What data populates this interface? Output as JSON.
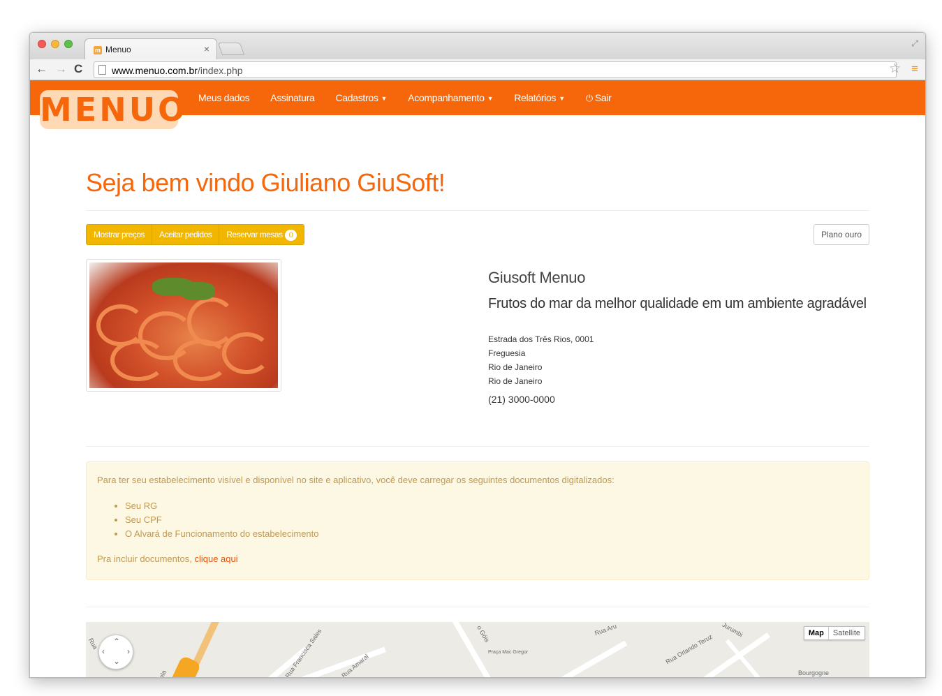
{
  "browser": {
    "tab_title": "Menuo",
    "tab_favicon": "m",
    "tab_close": "×",
    "url_host": "www.menuo.com.br",
    "url_path": "/index.php"
  },
  "site": {
    "logo": "MENUO",
    "brand_color": "#f5670a",
    "nav": {
      "meus_dados": "Meus dados",
      "assinatura": "Assinatura",
      "cadastros": "Cadastros",
      "acompanhamento": "Acompanhamento",
      "relatorios": "Relatórios",
      "sair": "Sair"
    }
  },
  "page": {
    "welcome": "Seja bem vindo Giuliano GiuSoft!",
    "buttons": {
      "mostrar_precos": "Mostrar preços",
      "aceitar_pedidos": "Aceitar pedidos",
      "reservar_mesas": "Reservar mesas",
      "reservas_count": "0",
      "plano": "Plano ouro"
    },
    "business": {
      "name": "Giusoft Menuo",
      "description": "Frutos do mar da melhor qualidade em um ambiente agradável",
      "address": [
        "Estrada dos Três Rios, 0001",
        "Freguesia",
        "Rio de Janeiro",
        "Rio de Janeiro"
      ],
      "phone": "(21) 3000-0000"
    },
    "alert": {
      "intro": "Para ter seu estabelecimento visível e disponível no site e aplicativo, você deve carregar os seguintes documentos digitalizados:",
      "items": [
        "Seu RG",
        "Seu CPF",
        "O Alvará de Funcionamento do estabelecimento"
      ],
      "footer_prefix": "Pra incluir documentos, ",
      "footer_link": "clique aqui"
    },
    "map": {
      "type_map": "Map",
      "type_satellite": "Satellite",
      "labels": [
        "Rua",
        "Rua Francisca Sales",
        "Rua Amaral",
        "o Góis",
        "Praça Mac Gregor",
        "Rua Aru",
        "Rua Orlando Teruz",
        "Jurumbi",
        "Bourgogne",
        "ela"
      ]
    }
  }
}
